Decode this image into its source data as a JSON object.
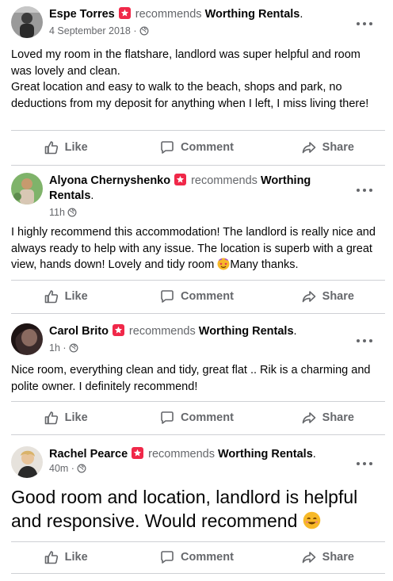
{
  "common": {
    "recommends": "recommends",
    "like": "Like",
    "comment": "Comment",
    "share": "Share"
  },
  "posts": [
    {
      "name": "Espe Torres",
      "page": "Worthing Rentals",
      "time": "4 September 2018",
      "text": "Loved my room in the flatshare, landlord was super helpful and room was lovely and clean.\nGreat location and easy to walk to the beach, shops and park, no deductions from my deposit for anything when I left, I miss living there!"
    },
    {
      "name": "Alyona Chernyshenko",
      "page": "Worthing",
      "page_line2": "Rentals",
      "time": "11h",
      "text": "I highly recommend this accommodation! The landlord is really nice and always ready to help with any issue. The location is superb with a great view, hands down! Lovely and tidy room ",
      "text_end": "Many thanks."
    },
    {
      "name": "Carol Brito",
      "page": "Worthing Rentals",
      "time": "1h",
      "text": "Nice room, everything clean and tidy, great flat .. Rik is a charming and polite owner. I definitely recommend!"
    },
    {
      "name": "Rachel Pearce",
      "page": "Worthing Rentals",
      "time": "40m",
      "text": "Good room and location, landlord is helpful and responsive. Would recommend "
    }
  ]
}
